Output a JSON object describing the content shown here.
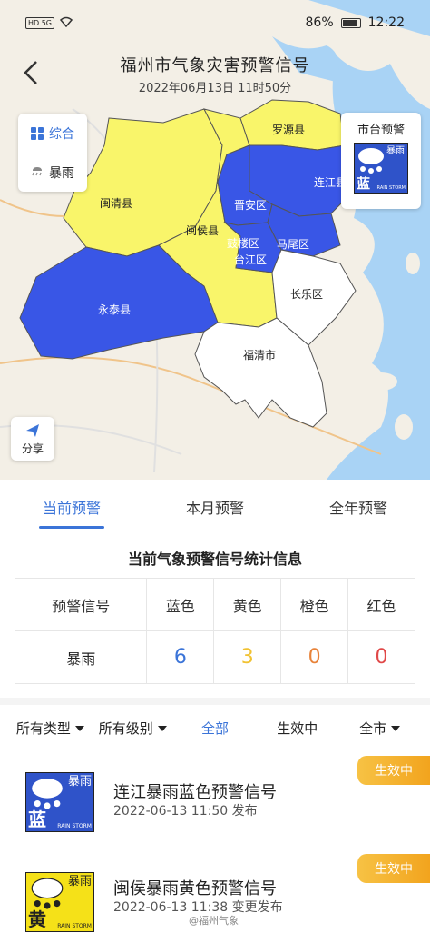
{
  "status_bar": {
    "left": "HD 5G",
    "battery": "86%",
    "time": "12:22"
  },
  "header": {
    "title": "福州市气象灾害预警信号",
    "datetime": "2022年06月13日 11时50分"
  },
  "layers": {
    "items": [
      {
        "label": "综合",
        "icon": "grid-icon",
        "active": true
      },
      {
        "label": "暴雨",
        "icon": "rain-icon",
        "active": false
      }
    ]
  },
  "share": {
    "label": "分享",
    "icon": "send-icon"
  },
  "city_warning": {
    "label": "市台预警",
    "icon": {
      "cn": "暴雨",
      "level": "蓝",
      "en": "RAIN STORM"
    }
  },
  "map": {
    "regions": [
      {
        "name": "闽清县",
        "level": "yellow"
      },
      {
        "name": "闽侯县",
        "level": "yellow"
      },
      {
        "name": "罗源县",
        "level": "yellow"
      },
      {
        "name": "连江县",
        "level": "blue"
      },
      {
        "name": "晋安区",
        "level": "blue"
      },
      {
        "name": "鼓楼区",
        "level": "blue"
      },
      {
        "name": "台江区",
        "level": "blue"
      },
      {
        "name": "马尾区",
        "level": "blue"
      },
      {
        "name": "永泰县",
        "level": "blue"
      },
      {
        "name": "长乐区",
        "level": "none"
      },
      {
        "name": "福清市",
        "level": "none"
      }
    ],
    "colors": {
      "yellow": "#f9f56a",
      "blue": "#3956e6",
      "none": "#ffffff",
      "sea": "#a9d3f5"
    }
  },
  "tabs": [
    {
      "label": "当前预警",
      "active": true
    },
    {
      "label": "本月预警",
      "active": false
    },
    {
      "label": "全年预警",
      "active": false
    }
  ],
  "stats": {
    "title": "当前气象预警信号统计信息",
    "headers": [
      "预警信号",
      "蓝色",
      "黄色",
      "橙色",
      "红色"
    ],
    "row": {
      "type": "暴雨",
      "blue": "6",
      "yellow": "3",
      "orange": "0",
      "red": "0"
    },
    "colors": {
      "blue": "#3b74d8",
      "yellow": "#f1c232",
      "orange": "#e8833a",
      "red": "#e04848"
    }
  },
  "filters": [
    {
      "label": "所有类型",
      "dropdown": true,
      "active": false
    },
    {
      "label": "所有级别",
      "dropdown": true,
      "active": false
    },
    {
      "label": "全部",
      "dropdown": false,
      "active": true
    },
    {
      "label": "生效中",
      "dropdown": false,
      "active": false
    },
    {
      "label": "全市",
      "dropdown": true,
      "active": false
    }
  ],
  "warnings": [
    {
      "title": "连江暴雨蓝色预警信号",
      "time": "2022-06-13 11:50",
      "action": "发布",
      "status": "生效中",
      "icon": {
        "cn": "暴雨",
        "level": "蓝",
        "en": "RAIN STORM",
        "color": "blue"
      }
    },
    {
      "title": "闽侯暴雨黄色预警信号",
      "time": "2022-06-13 11:38",
      "action": "变更发布",
      "status": "生效中",
      "icon": {
        "cn": "暴雨",
        "level": "黄",
        "en": "RAIN STORM",
        "color": "yellow"
      }
    }
  ],
  "watermark": "@福州气象"
}
